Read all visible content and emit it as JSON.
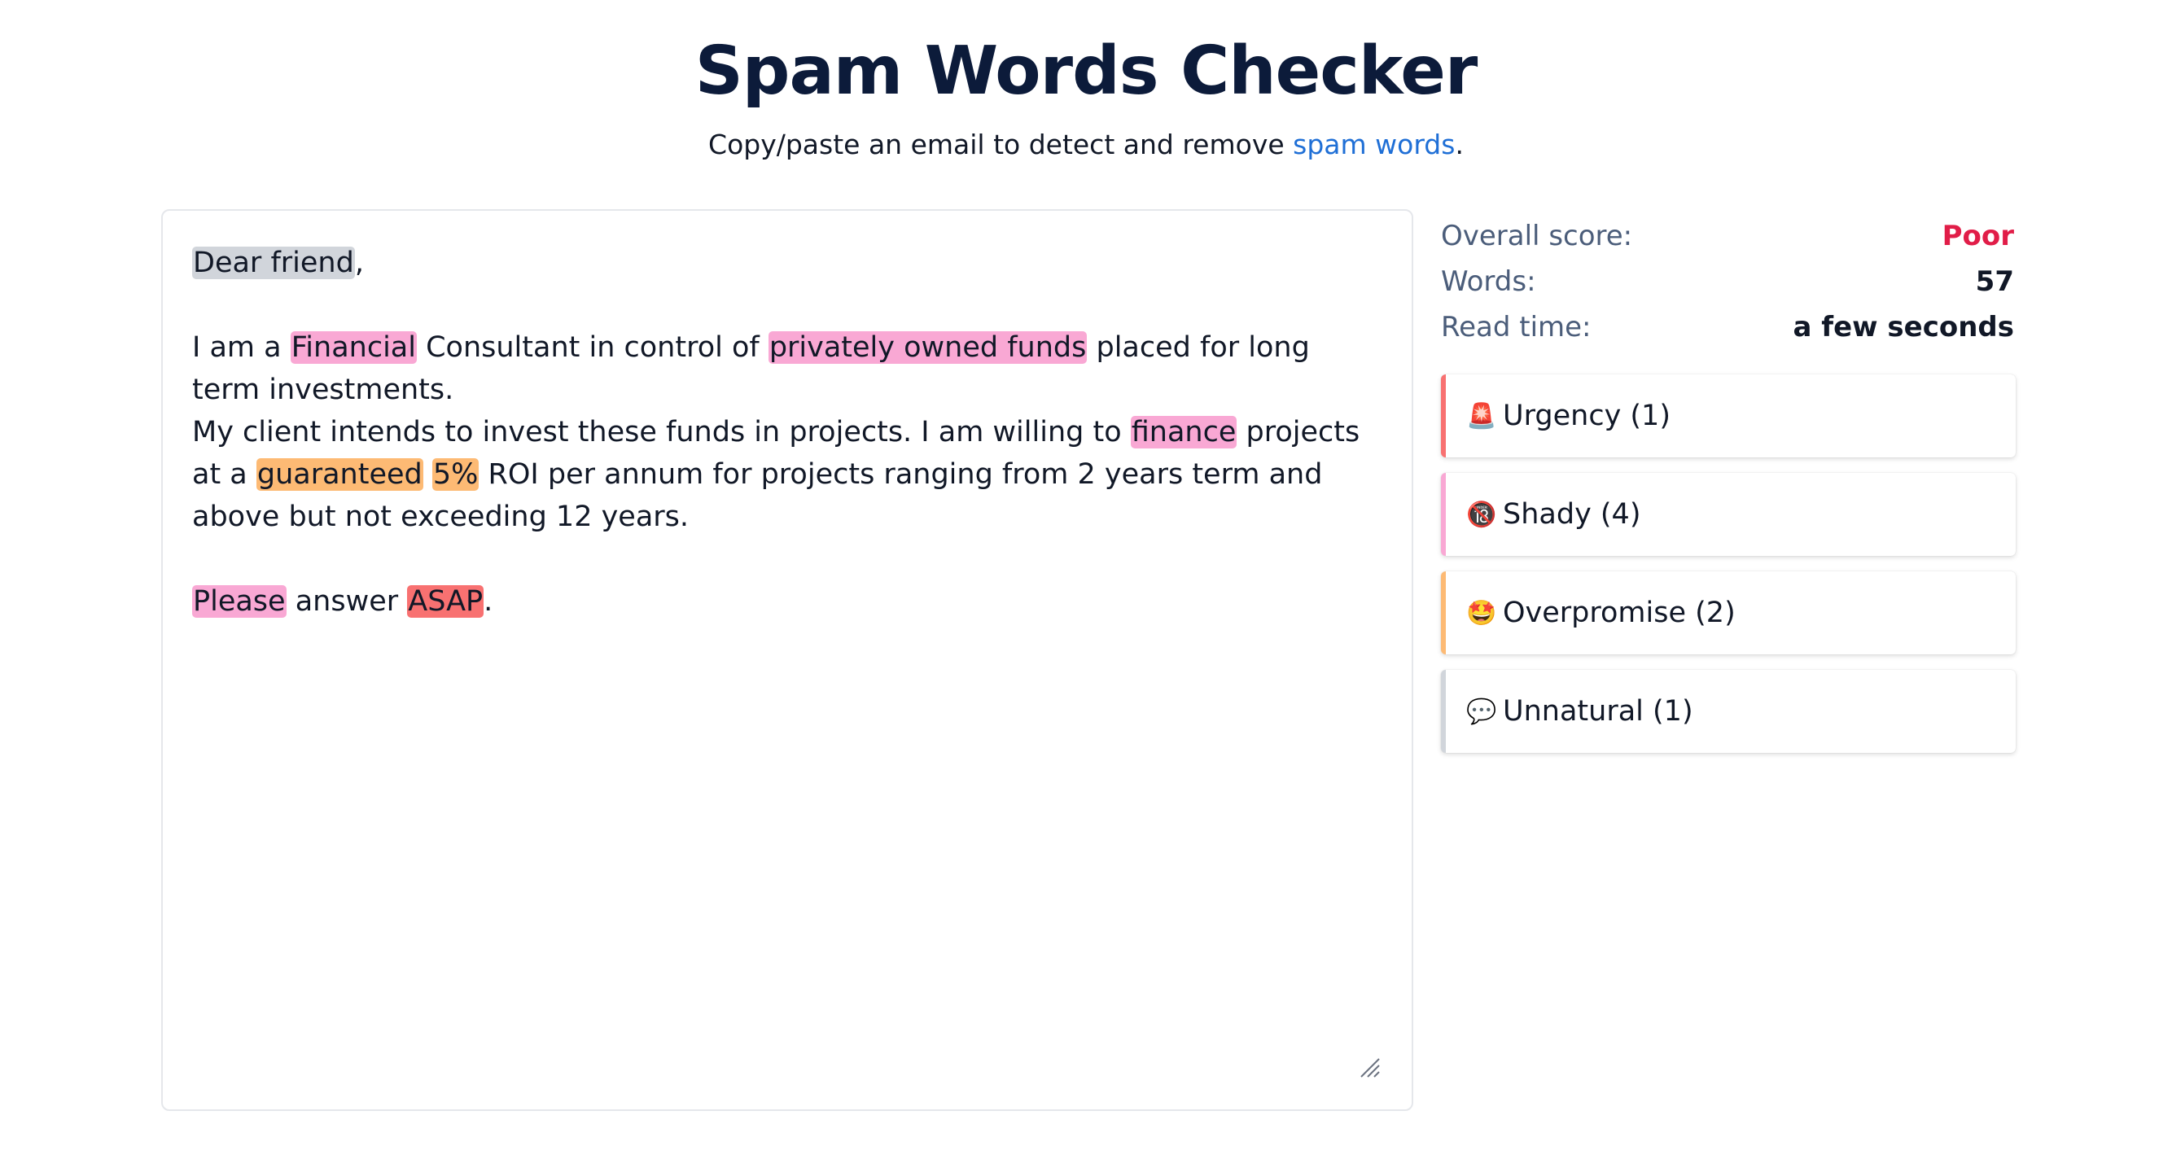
{
  "header": {
    "title": "Spam Words Checker",
    "subtitle_pre": "Copy/paste an email to detect and remove ",
    "subtitle_link": "spam words",
    "subtitle_post": "."
  },
  "email": {
    "greeting_hl": "Dear friend",
    "greeting_tail": ",",
    "p1_a": "I am a ",
    "p1_hl1": "Financial",
    "p1_b": " Consultant in control of ",
    "p1_hl2": "privately owned funds",
    "p1_c": " placed for long term investments.",
    "p2_a": "My client intends to invest these funds in projects. I am willing to ",
    "p2_hl1": "finance",
    "p2_b": " projects at a ",
    "p2_hl2": "guaranteed",
    "p2_c": " ",
    "p2_hl3": "5%",
    "p2_d": " ROI per annum for projects ranging from 2 years term and above but not exceeding 12 years.",
    "p3_hl1": "Please",
    "p3_a": " answer ",
    "p3_hl2": "ASAP",
    "p3_b": "."
  },
  "stats": {
    "score_label": "Overall score:",
    "score_value": "Poor",
    "words_label": "Words:",
    "words_value": "57",
    "read_label": "Read time:",
    "read_value": "a few seconds"
  },
  "categories": [
    {
      "emoji": "🚨",
      "icon": "siren-icon",
      "label": "Urgency (1)",
      "color": "#f87171"
    },
    {
      "emoji": "🔞",
      "icon": "no-under-18-icon",
      "label": "Shady (4)",
      "color": "#f9a8d4"
    },
    {
      "emoji": "🤩",
      "icon": "star-struck-icon",
      "label": "Overpromise (2)",
      "color": "#fdba74"
    },
    {
      "emoji": "💬",
      "icon": "speech-bubble-icon",
      "label": "Unnatural (1)",
      "color": "#d1d5db"
    }
  ],
  "colors": {
    "title": "#0c1b3a",
    "link": "#1f6fd6",
    "poor": "#e11d48",
    "highlight_grey": "#d1d5db",
    "highlight_pink": "#f9a8d4",
    "highlight_orange": "#fdba74",
    "highlight_red": "#f87171"
  }
}
